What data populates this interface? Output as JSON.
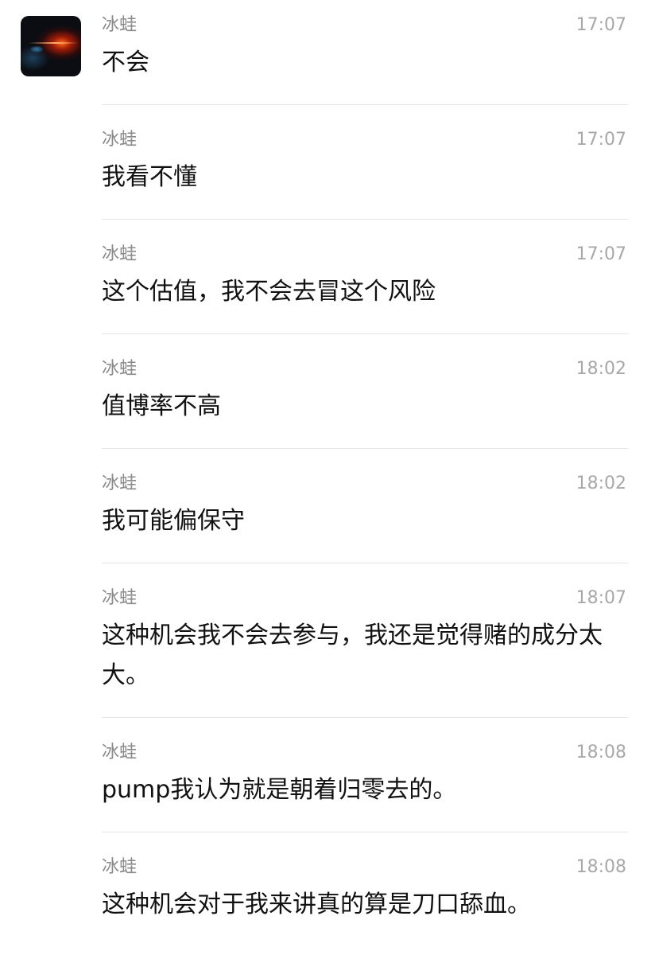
{
  "messages": [
    {
      "sender": "冰蛙",
      "time": "17:07",
      "text": "不会"
    },
    {
      "sender": "冰蛙",
      "time": "17:07",
      "text": "我看不懂"
    },
    {
      "sender": "冰蛙",
      "time": "17:07",
      "text": "这个估值，我不会去冒这个风险"
    },
    {
      "sender": "冰蛙",
      "time": "18:02",
      "text": "值博率不高"
    },
    {
      "sender": "冰蛙",
      "time": "18:02",
      "text": "我可能偏保守"
    },
    {
      "sender": "冰蛙",
      "time": "18:07",
      "text": "这种机会我不会去参与，我还是觉得赌的成分太大。"
    },
    {
      "sender": "冰蛙",
      "time": "18:08",
      "text": "pump我认为就是朝着归零去的。"
    },
    {
      "sender": "冰蛙",
      "time": "18:08",
      "text": "这种机会对于我来讲真的算是刀口舔血。"
    }
  ]
}
